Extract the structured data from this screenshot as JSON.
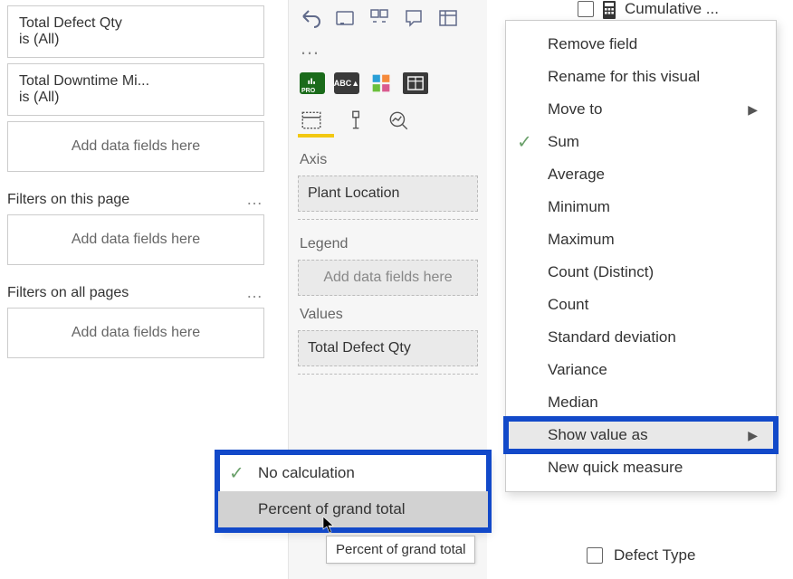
{
  "filters": {
    "card1": {
      "title": "Total Defect Qty",
      "subtitle": "is (All)"
    },
    "card2": {
      "title": "Total Downtime Mi...",
      "subtitle": "is (All)"
    },
    "add_placeholder": "Add data fields here",
    "section_page": "Filters on this page",
    "section_all": "Filters on all pages"
  },
  "viz": {
    "axis_label": "Axis",
    "axis_value": "Plant Location",
    "legend_label": "Legend",
    "legend_placeholder": "Add data fields here",
    "values_label": "Values",
    "values_value": "Total Defect Qty"
  },
  "fields_header": "Cumulative ...",
  "context_menu": {
    "remove": "Remove field",
    "rename": "Rename for this visual",
    "moveto": "Move to",
    "sum": "Sum",
    "average": "Average",
    "minimum": "Minimum",
    "maximum": "Maximum",
    "count_distinct": "Count (Distinct)",
    "count": "Count",
    "stddev": "Standard deviation",
    "variance": "Variance",
    "median": "Median",
    "show_value_as": "Show value as",
    "new_quick": "New quick measure"
  },
  "submenu": {
    "no_calc": "No calculation",
    "percent_grand": "Percent of grand total"
  },
  "tooltip": "Percent of grand total",
  "defect_type_label": "Defect Type"
}
